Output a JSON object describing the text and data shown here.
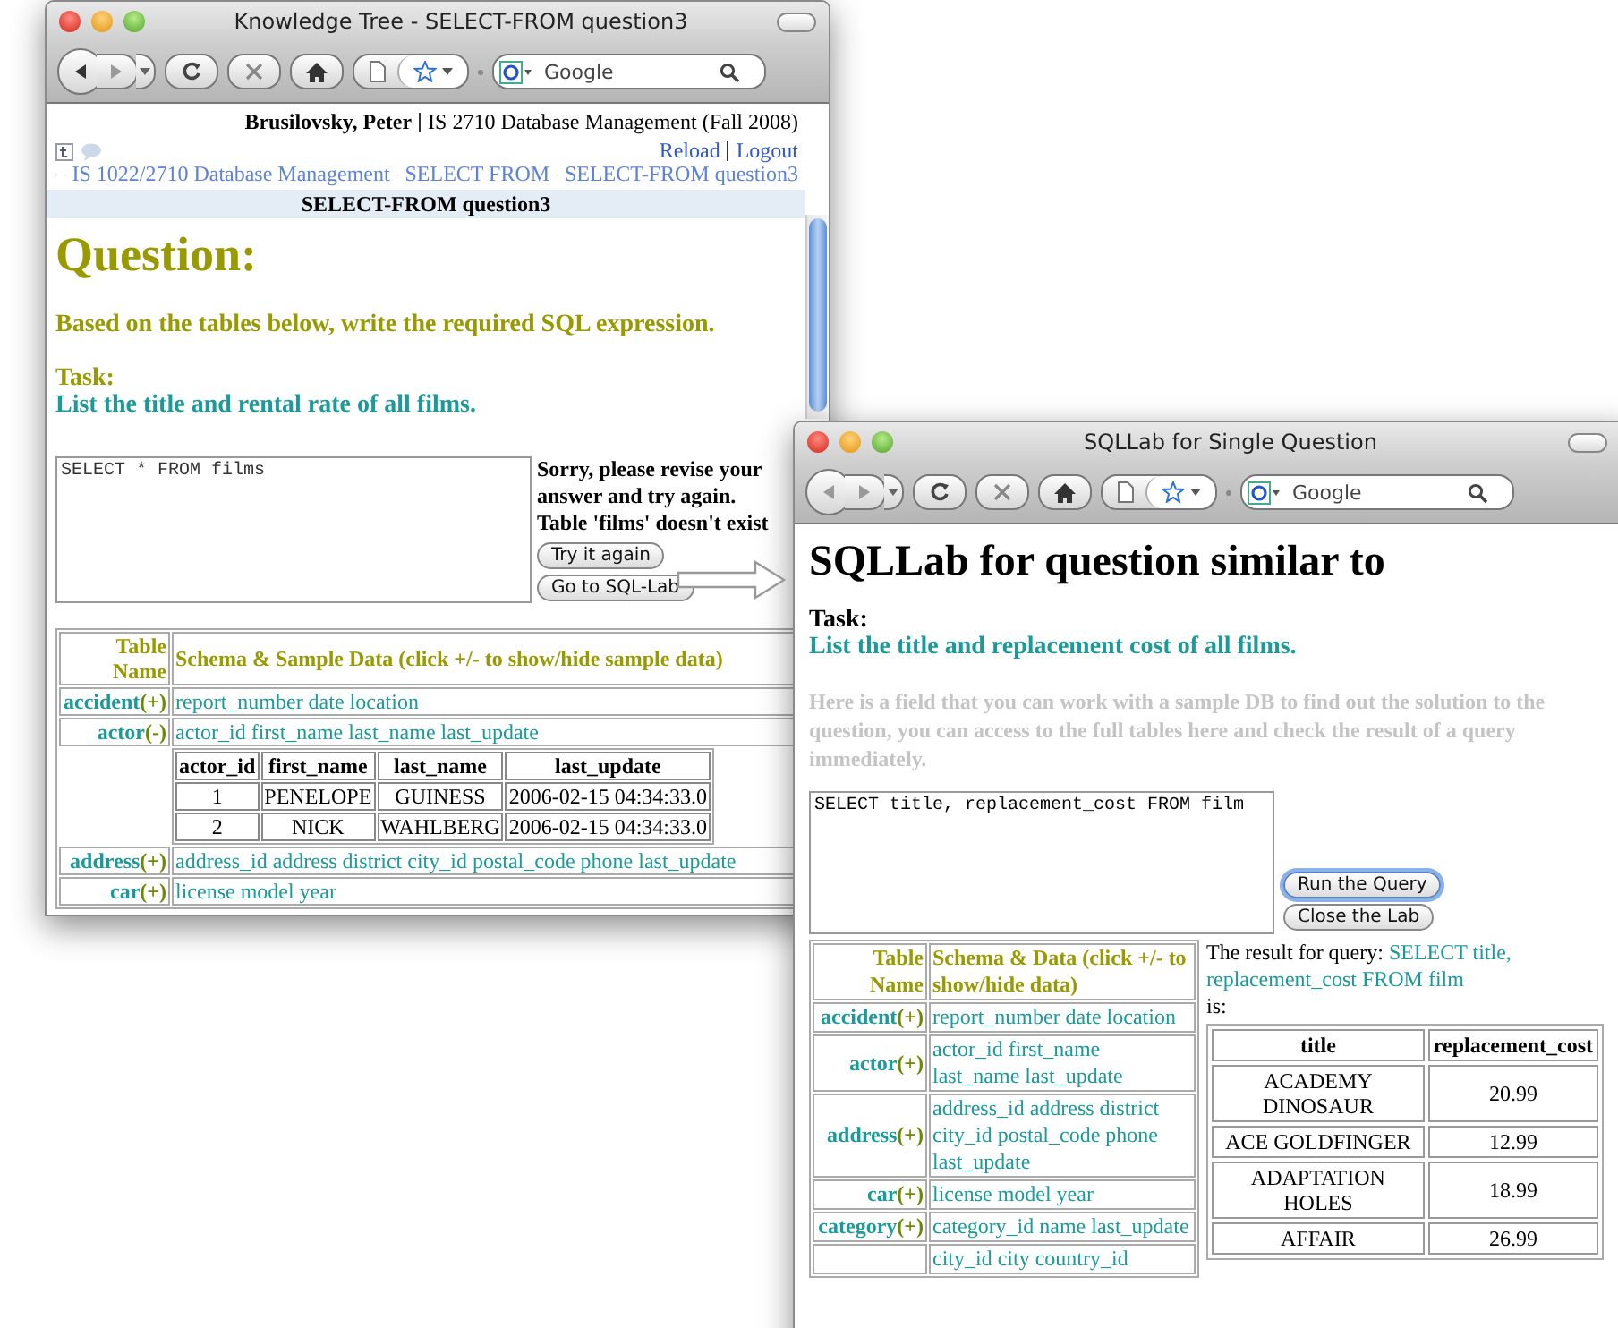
{
  "windows": [
    {
      "kind": "question",
      "title": "Knowledge Tree - SELECT-FROM question3",
      "search": {
        "placeholder": "Google"
      },
      "user": "Brusilovsky, Peter",
      "course": "IS 2710 Database Management (Fall 2008)",
      "links": [
        "Reload",
        "Logout"
      ],
      "breadcrumb": [
        "IS 1022/2710 Database Management",
        "SELECT FROM",
        "SELECT-FROM question3"
      ],
      "page_title": "SELECT-FROM question3",
      "heading": "Question:",
      "prompt": "Based on the tables below, write the required SQL expression.",
      "task_label": "Task:",
      "task": "List the title and rental rate of all films.",
      "answer": {
        "value": "SELECT * FROM films"
      },
      "feedback": "Sorry, please revise your answer and try again. Table 'films' doesn't exist",
      "buttons": [
        {
          "label": "Try it again",
          "default": false
        },
        {
          "label": "Go to SQL-Lab",
          "default": false
        }
      ],
      "schema": {
        "columns": [
          "Table Name",
          "Schema & Sample Data (click +/- to show/hide sample data)"
        ],
        "rows": [
          {
            "name": "accident",
            "toggle": "(+)",
            "schema": "report_number date location"
          },
          {
            "name": "actor",
            "toggle": "(-)",
            "schema": "actor_id first_name last_name last_update",
            "sample": {
              "columns": [
                "actor_id",
                "first_name",
                "last_name",
                "last_update"
              ],
              "rows": [
                [
                  "1",
                  "PENELOPE",
                  "GUINESS",
                  "2006-02-15 04:34:33.0"
                ],
                [
                  "2",
                  "NICK",
                  "WAHLBERG",
                  "2006-02-15 04:34:33.0"
                ]
              ]
            }
          },
          {
            "name": "address",
            "toggle": "(+)",
            "schema": "address_id address district city_id postal_code phone last_update"
          },
          {
            "name": "car",
            "toggle": "(+)",
            "schema": "license model year"
          }
        ]
      }
    },
    {
      "kind": "lab",
      "title": "SQLLab for Single Question",
      "search": {
        "placeholder": "Google"
      },
      "heading": "SQLLab for question similar to",
      "task_label": "Task:",
      "task": "List the title and replacement cost of all films.",
      "note": "Here is a field that you can work with a sample DB to find out the solution to the question, you can access to the full tables here and check the result of a query immediately.",
      "query": {
        "value": "SELECT title, replacement_cost FROM film"
      },
      "buttons": [
        {
          "label": "Run the Query",
          "default": true
        },
        {
          "label": "Close the Lab",
          "default": false
        }
      ],
      "schema": {
        "columns": [
          "Table Name",
          "Schema & Data (click +/- to show/hide data)"
        ],
        "rows": [
          {
            "name": "accident",
            "toggle": "(+)",
            "schema": "report_number date location"
          },
          {
            "name": "actor",
            "toggle": "(+)",
            "schema": "actor_id first_name last_name last_update"
          },
          {
            "name": "address",
            "toggle": "(+)",
            "schema": "address_id address district city_id postal_code phone last_update"
          },
          {
            "name": "car",
            "toggle": "(+)",
            "schema": "license model year"
          },
          {
            "name": "category",
            "toggle": "(+)",
            "schema": "category_id name last_update"
          },
          {
            "schema": "city_id city country_id"
          }
        ]
      },
      "result": {
        "prefix": "The result for query:",
        "query": "SELECT title, replacement_cost FROM film",
        "suffix": "is:",
        "columns": [
          "title",
          "replacement_cost"
        ],
        "rows": [
          [
            "ACADEMY DINOSAUR",
            "20.99"
          ],
          [
            "ACE GOLDFINGER",
            "12.99"
          ],
          [
            "ADAPTATION HOLES",
            "18.99"
          ],
          [
            "AFFAIR",
            "26.99"
          ]
        ]
      }
    }
  ]
}
